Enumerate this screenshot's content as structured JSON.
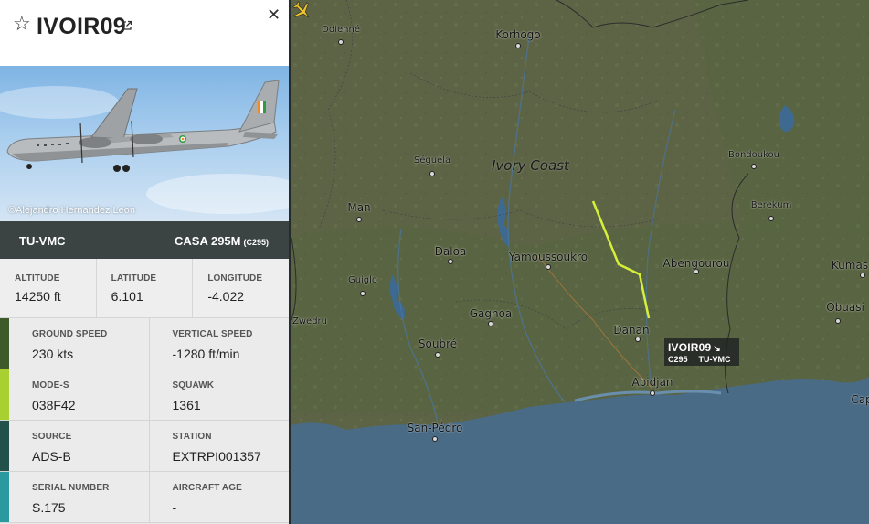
{
  "flight": {
    "callsign": "IVOIR09",
    "registration": "TU-VMC",
    "aircraft_type": "CASA 295M",
    "type_code": "(C295)",
    "photo_credit": "©Alejandro Hernandez Leon"
  },
  "details": {
    "altitude": {
      "label": "ALTITUDE",
      "value": "14250 ft"
    },
    "latitude": {
      "label": "LATITUDE",
      "value": "6.101"
    },
    "longitude": {
      "label": "LONGITUDE",
      "value": "-4.022"
    },
    "ground_speed": {
      "label": "GROUND SPEED",
      "value": "230 kts"
    },
    "vertical_speed": {
      "label": "VERTICAL SPEED",
      "value": "-1280 ft/min"
    },
    "mode_s": {
      "label": "MODE-S",
      "value": "038F42"
    },
    "squawk": {
      "label": "SQUAWK",
      "value": "1361"
    },
    "source": {
      "label": "SOURCE",
      "value": "ADS-B"
    },
    "station": {
      "label": "STATION",
      "value": "EXTRPI001357"
    },
    "serial_number": {
      "label": "SERIAL NUMBER",
      "value": "S.175"
    },
    "aircraft_age": {
      "label": "AIRCRAFT AGE",
      "value": "-"
    }
  },
  "map": {
    "country_label": "Ivory Coast",
    "cities": {
      "odienne": "Odienné",
      "korhogo": "Korhogo",
      "seguela": "Séguéla",
      "bondoukou": "Bondoukou",
      "berekum": "Berekum",
      "man": "Man",
      "daloa": "Daloa",
      "yamoussoukro": "Yamoussoukro",
      "abengourou": "Abengourou",
      "kumasi": "Kumas",
      "guiglo": "Guiglo",
      "gagnoa": "Gagnoa",
      "obuasi": "Obuasi",
      "zwedru": "Zwedru",
      "soubre": "Soubré",
      "danane": "Danan",
      "abidjan": "Abidjan",
      "san_pedro": "San-Pédro",
      "cape": "Cap"
    },
    "callout": {
      "callsign": "IVOIR09",
      "arrow": "↘",
      "type": "C295",
      "registration": "TU-VMC"
    }
  },
  "colors": {
    "track": "#d6f03a",
    "ocean": "#4a6b85",
    "land": "#5f6648",
    "stripe_speed": "#3e5a2a",
    "stripe_mode": "#a8d030",
    "stripe_source": "#22504a",
    "stripe_serial": "#2a9aa0"
  },
  "icons": [
    "star-icon",
    "external-link-icon",
    "close-icon",
    "aircraft-icon"
  ]
}
